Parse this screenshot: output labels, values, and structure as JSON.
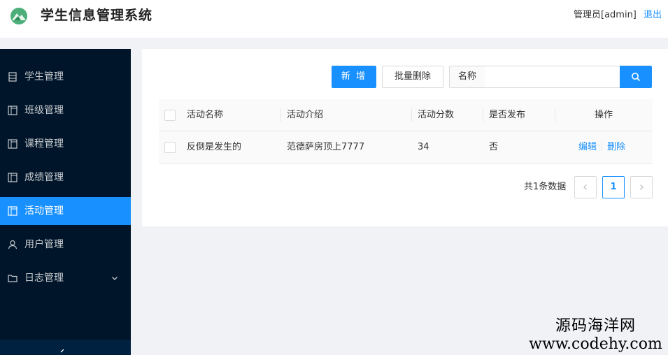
{
  "header": {
    "title": "学生信息管理系统",
    "user_label": "管理员[admin]",
    "logout": "退出"
  },
  "sidebar": {
    "items": [
      {
        "label": "学生管理",
        "icon": "table-icon"
      },
      {
        "label": "班级管理",
        "icon": "layout-icon"
      },
      {
        "label": "课程管理",
        "icon": "layout-icon"
      },
      {
        "label": "成绩管理",
        "icon": "layout-icon"
      },
      {
        "label": "活动管理",
        "icon": "layout-icon",
        "active": true
      },
      {
        "label": "用户管理",
        "icon": "user-icon"
      },
      {
        "label": "日志管理",
        "icon": "folder-icon",
        "has_submenu": true
      }
    ]
  },
  "toolbar": {
    "add_label": "新 增",
    "batch_delete_label": "批量删除",
    "search_addon": "名称",
    "search_value": ""
  },
  "table": {
    "columns": [
      "活动名称",
      "活动介绍",
      "活动分数",
      "是否发布",
      "操作"
    ],
    "rows": [
      {
        "name": "反倒是发生的",
        "intro": "范德萨房顶上7777",
        "score": "34",
        "published": "否",
        "edit": "编辑",
        "delete": "删除"
      }
    ]
  },
  "pagination": {
    "total_text": "共1条数据",
    "current_page": "1"
  },
  "watermark": {
    "line1": "源码海洋网",
    "line2": "www.codehy.com"
  },
  "colors": {
    "primary": "#1890ff",
    "sidebar_bg": "#001529",
    "page_bg": "#f0f2f5"
  }
}
